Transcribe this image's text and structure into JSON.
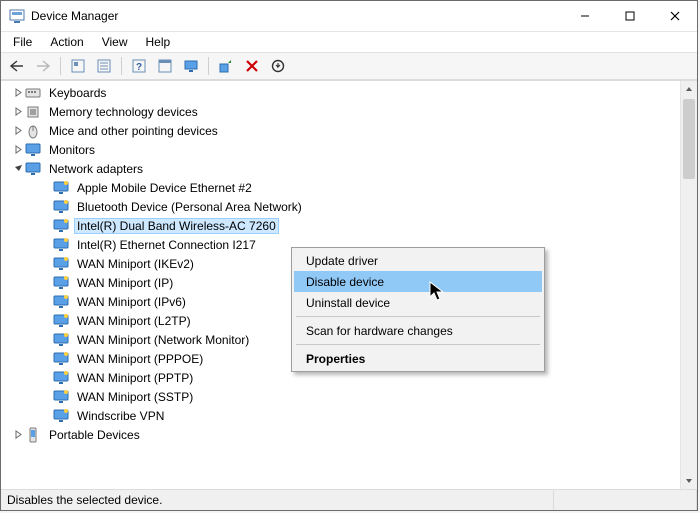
{
  "title": "Device Manager",
  "menubar": [
    "File",
    "Action",
    "View",
    "Help"
  ],
  "toolbar_icons": [
    "back-icon",
    "forward-icon",
    "show-hidden-icon",
    "properties-icon",
    "help-icon",
    "details-icon",
    "computer-icon",
    "scan-icon",
    "disable-icon",
    "uninstall-icon"
  ],
  "tree": {
    "collapsed": [
      {
        "label": "Keyboards",
        "icon": "keyboard"
      },
      {
        "label": "Memory technology devices",
        "icon": "chip"
      },
      {
        "label": "Mice and other pointing devices",
        "icon": "mouse"
      },
      {
        "label": "Monitors",
        "icon": "monitor"
      }
    ],
    "expanded": {
      "label": "Network adapters",
      "icon": "monitor",
      "children": [
        "Apple Mobile Device Ethernet #2",
        "Bluetooth Device (Personal Area Network)",
        "Intel(R) Dual Band Wireless-AC 7260",
        "Intel(R) Ethernet Connection I217",
        "WAN Miniport (IKEv2)",
        "WAN Miniport (IP)",
        "WAN Miniport (IPv6)",
        "WAN Miniport (L2TP)",
        "WAN Miniport (Network Monitor)",
        "WAN Miniport (PPPOE)",
        "WAN Miniport (PPTP)",
        "WAN Miniport (SSTP)",
        "Windscribe VPN"
      ],
      "selected_index": 2
    },
    "collapsed_after": [
      {
        "label": "Portable Devices",
        "icon": "portable"
      }
    ]
  },
  "context_menu": {
    "items": [
      {
        "label": "Update driver",
        "highlight": false
      },
      {
        "label": "Disable device",
        "highlight": true
      },
      {
        "label": "Uninstall device",
        "highlight": false
      }
    ],
    "after_divider": [
      {
        "label": "Scan for hardware changes",
        "highlight": false
      }
    ],
    "bold": {
      "label": "Properties"
    }
  },
  "status": "Disables the selected device."
}
